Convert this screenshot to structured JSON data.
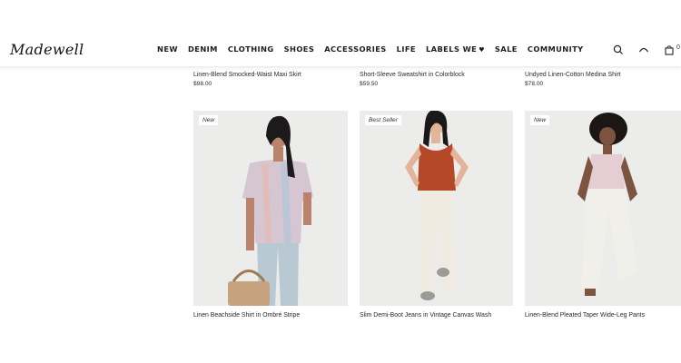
{
  "brand": {
    "logo": "Madewell"
  },
  "nav": {
    "items": [
      "NEW",
      "DENIM",
      "CLOTHING",
      "SHOES",
      "ACCESSORIES",
      "LIFE",
      "LABELS WE",
      "SALE",
      "COMMUNITY"
    ],
    "labels_we_icon": "heart-icon"
  },
  "header_icons": {
    "search": "search-icon",
    "account": "account-icon",
    "bag": "bag-icon",
    "bag_count": "0"
  },
  "top_row": [
    {
      "name": "Linen-Blend Smocked-Waist Maxi Skirt",
      "price": "$98.00"
    },
    {
      "name": "Short-Sleeve Sweatshirt in Colorblock",
      "price": "$59.50"
    },
    {
      "name": "Undyed Linen-Cotton Medina Shirt",
      "price": "$78.00"
    }
  ],
  "products": [
    {
      "badge": "New",
      "name": "Linen Beachside Shirt in Ombré Stripe"
    },
    {
      "badge": "Best Seller",
      "name": "Slim Demi-Boot Jeans in Vintage Canvas Wash"
    },
    {
      "badge": "New",
      "name": "Linen-Blend Pleated Taper Wide-Leg Pants"
    }
  ],
  "colors": {
    "text": "#1d1d1d",
    "photo_bg": "#ececec",
    "top_rust": "#b6482a"
  }
}
